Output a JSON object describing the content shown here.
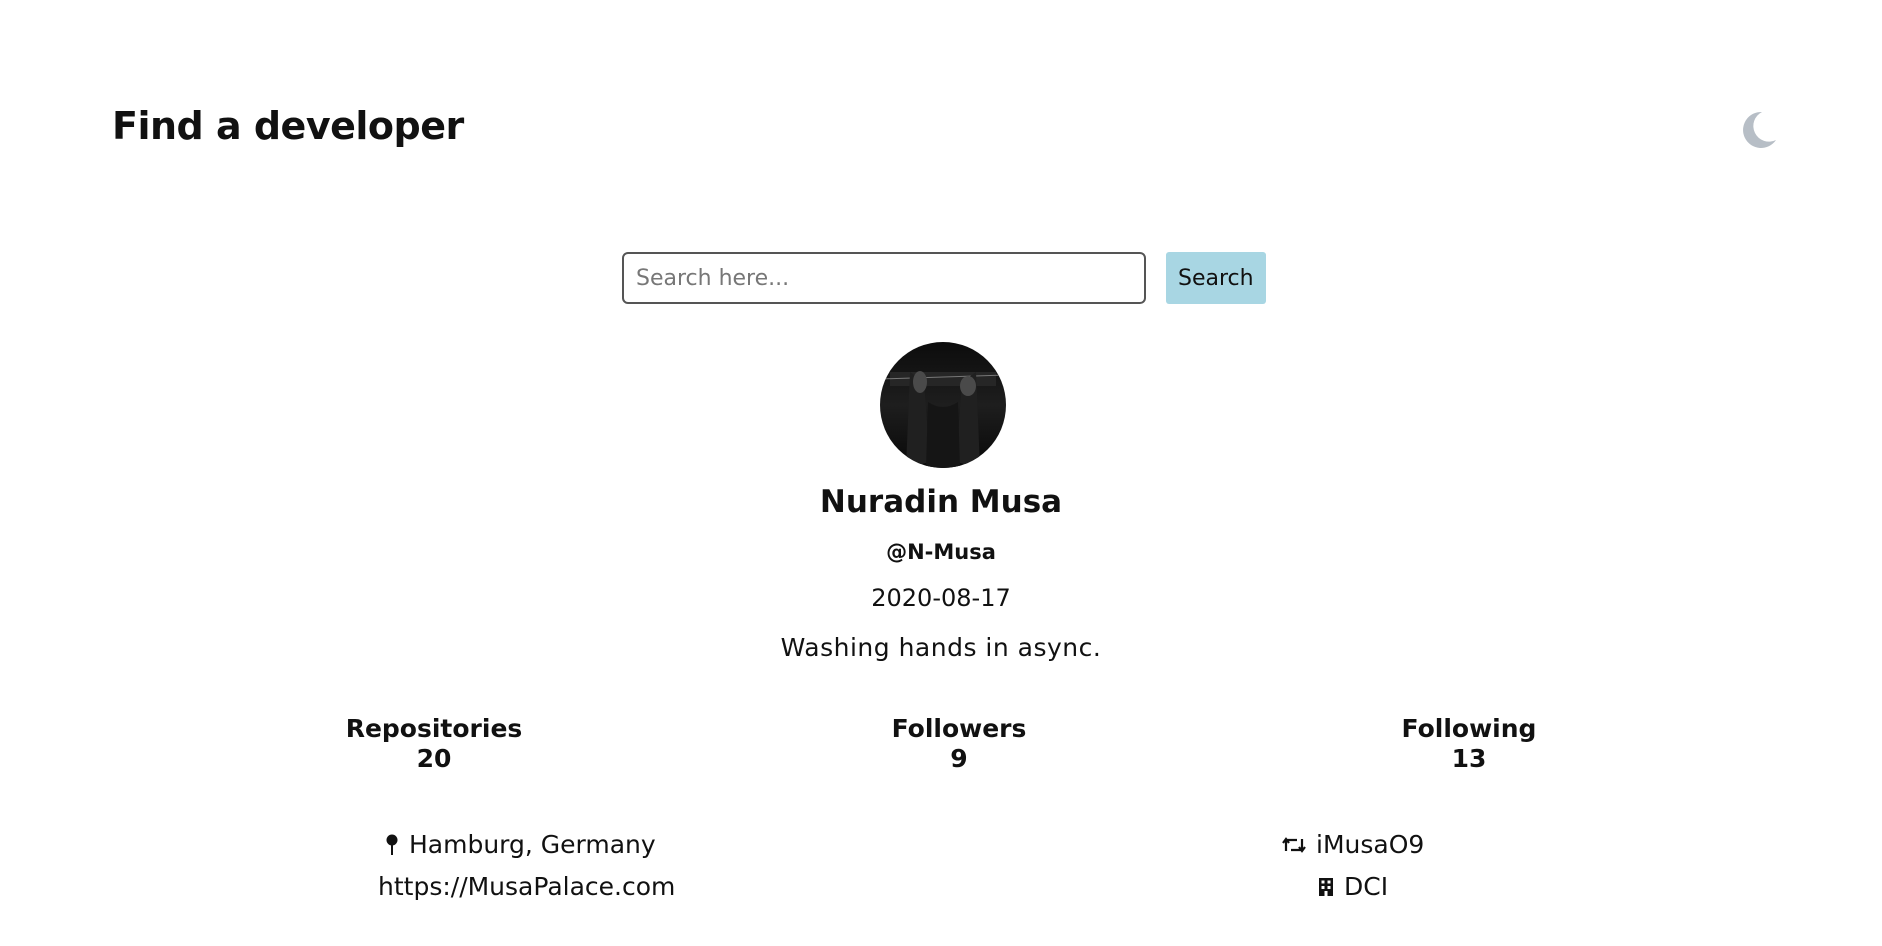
{
  "header": {
    "title": "Find a developer",
    "theme_icon": "moon-icon"
  },
  "search": {
    "placeholder": "Search here...",
    "value": "",
    "button_label": "Search"
  },
  "profile": {
    "avatar_icon": "avatar",
    "name": "Nuradin Musa",
    "login": "@N-Musa",
    "joined": "2020-08-17",
    "bio": "Washing hands in async."
  },
  "stats": {
    "repositories": {
      "label": "Repositories",
      "value": "20"
    },
    "followers": {
      "label": "Followers",
      "value": "9"
    },
    "following": {
      "label": "Following",
      "value": "13"
    }
  },
  "info": {
    "location": {
      "icon": "map-pin-icon",
      "text": "Hamburg, Germany"
    },
    "website": {
      "text": "https://MusaPalace.com"
    },
    "twitter": {
      "icon": "retweet-icon",
      "text": "iMusaO9"
    },
    "company": {
      "icon": "building-icon",
      "text": "DCI"
    }
  },
  "colors": {
    "search_button_bg": "#a8d6e3",
    "moon_icon": "#b7bec6",
    "text": "#111111"
  }
}
